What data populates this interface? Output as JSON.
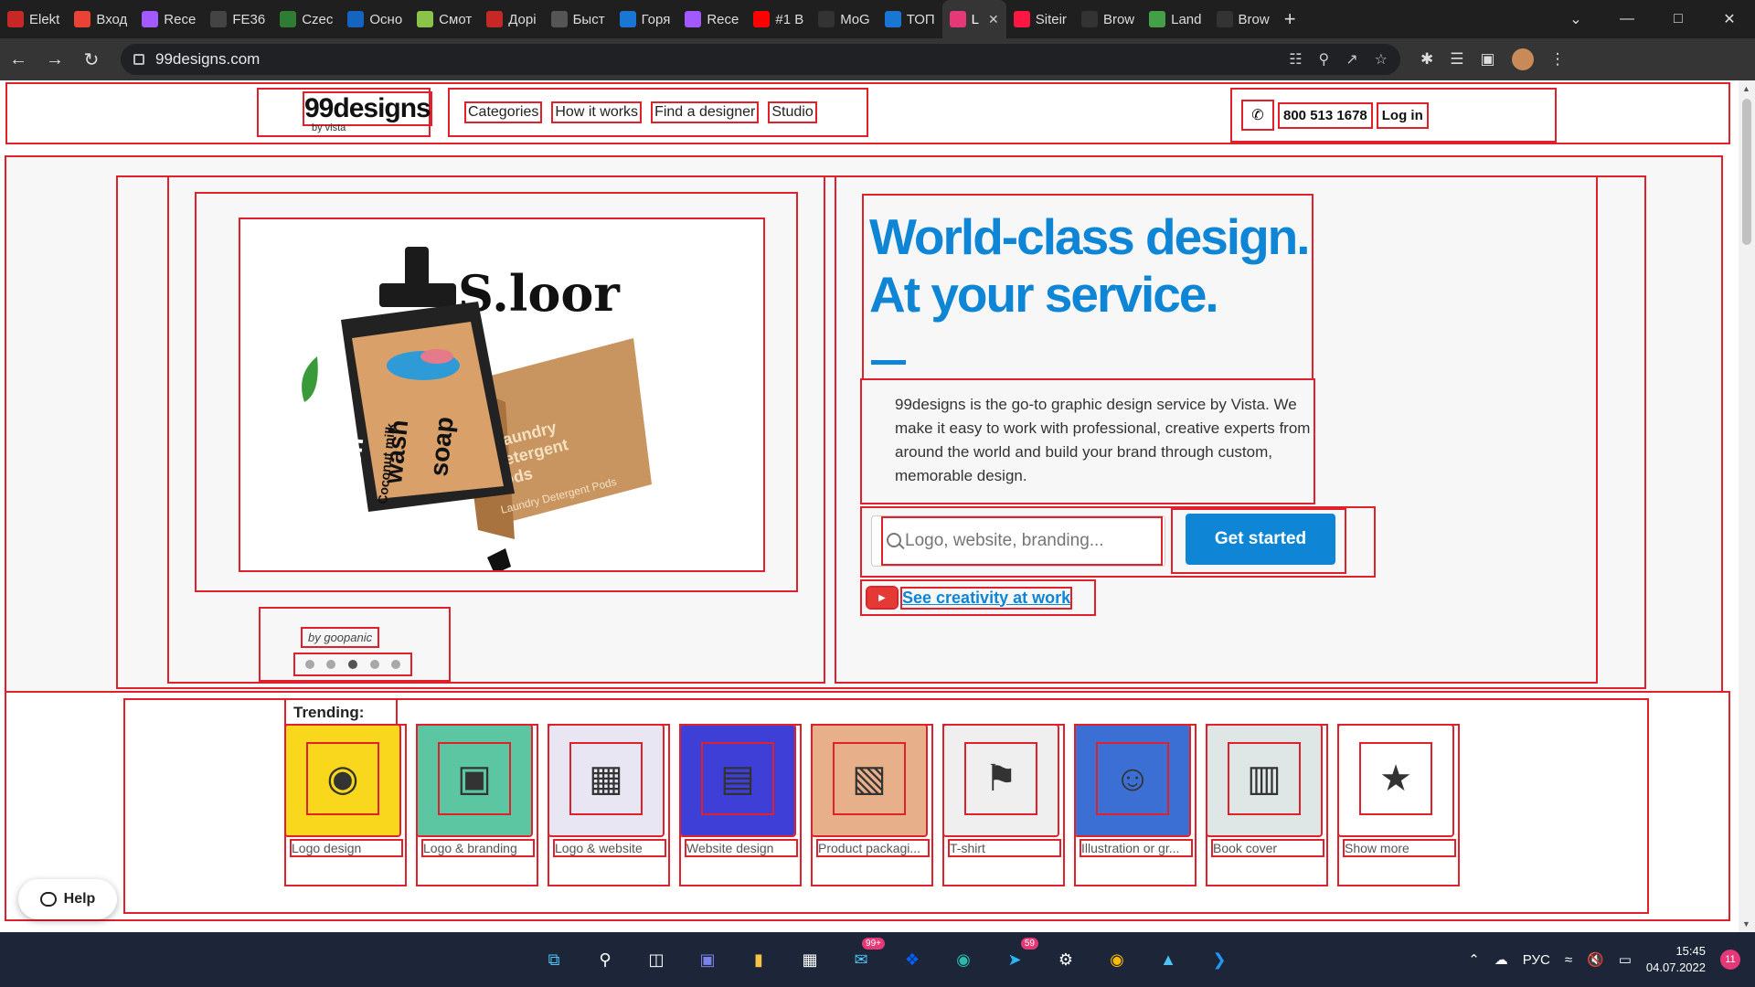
{
  "browser": {
    "tabs": [
      {
        "label": "Elekt",
        "icon": "uis-icon",
        "color": "#c62828"
      },
      {
        "label": "Вход",
        "icon": "gmail-icon",
        "color": "#ea4335"
      },
      {
        "label": "Rece",
        "icon": "figma-icon",
        "color": "#a259ff"
      },
      {
        "label": "FE36",
        "icon": "github-icon",
        "color": "#444"
      },
      {
        "label": "Czec",
        "icon": "cu-icon",
        "color": "#2e7d32"
      },
      {
        "label": "Осно",
        "icon": "bc-icon",
        "color": "#1565c0"
      },
      {
        "label": "Смот",
        "icon": "globe-icon",
        "color": "#8bc34a"
      },
      {
        "label": "Дорі",
        "icon": "dl-icon",
        "color": "#c62828"
      },
      {
        "label": "Быст",
        "icon": "blank-icon",
        "color": "#555"
      },
      {
        "label": "Горя",
        "icon": "globe-icon",
        "color": "#1976d2"
      },
      {
        "label": "Rece",
        "icon": "figma-icon",
        "color": "#a259ff"
      },
      {
        "label": "#1 B",
        "icon": "youtube-icon",
        "color": "#ff0000"
      },
      {
        "label": "MoG",
        "icon": "mog-icon",
        "color": "#333"
      },
      {
        "label": "ТОП",
        "icon": "chart-icon",
        "color": "#1976d2"
      },
      {
        "label": "L",
        "icon": "99d-icon",
        "color": "#e53977"
      },
      {
        "label": "Siteir",
        "icon": "red-dot-icon",
        "color": "#ff1744"
      },
      {
        "label": "Brow",
        "icon": "brow-icon",
        "color": "#333"
      },
      {
        "label": "Land",
        "icon": "land-icon",
        "color": "#43a047"
      },
      {
        "label": "Brow",
        "icon": "brow-icon",
        "color": "#333"
      }
    ],
    "new_tab": "+",
    "url": "99designs.com"
  },
  "header": {
    "logo": "99designs",
    "logo_sub": "by vista",
    "nav": [
      "Categories",
      "How it works",
      "Find a designer",
      "Studio"
    ],
    "phone": "800 513 1678",
    "login": "Log in"
  },
  "hero": {
    "headline_1": "World-class design.",
    "headline_2": "At your service.",
    "description": "99designs is the go-to graphic design service by Vista. We make it easy to work with professional, creative experts from around the world and build your brand through custom, memorable design.",
    "search_placeholder": "Logo, website, branding...",
    "cta": "Get started",
    "creativity_link": "See creativity at work",
    "credit": "by goopanic",
    "carousel_active": 3,
    "carousel_count": 5,
    "image_text": {
      "brand": "S.loor",
      "bottle_1": "Dish",
      "bottle_2": "wash",
      "bottle_3": "soap",
      "bottle_4": "Coconut milk",
      "box_1": "Laundry",
      "box_2": "Detergent",
      "box_3": "Pods",
      "box_4": "Laundry Detergent Pods"
    }
  },
  "trending": {
    "title": "Trending:",
    "items": [
      {
        "label": "Logo design",
        "bg": "#f9d71c"
      },
      {
        "label": "Logo & branding",
        "bg": "#5cc6a3"
      },
      {
        "label": "Logo & website",
        "bg": "#e8e6f2"
      },
      {
        "label": "Website design",
        "bg": "#3d3fd6"
      },
      {
        "label": "Product packagi...",
        "bg": "#e8b08a"
      },
      {
        "label": "T-shirt",
        "bg": "#efefef"
      },
      {
        "label": "Illustration or gr...",
        "bg": "#3b6fd4"
      },
      {
        "label": "Book cover",
        "bg": "#dfe6e6"
      },
      {
        "label": "Show more",
        "bg": "#ffffff"
      }
    ]
  },
  "help": {
    "label": "Help"
  },
  "taskbar": {
    "mail_badge": "99+",
    "telegram_badge": "59",
    "lang": "РУС",
    "time": "15:45",
    "date": "04.07.2022",
    "notifications": "11"
  }
}
